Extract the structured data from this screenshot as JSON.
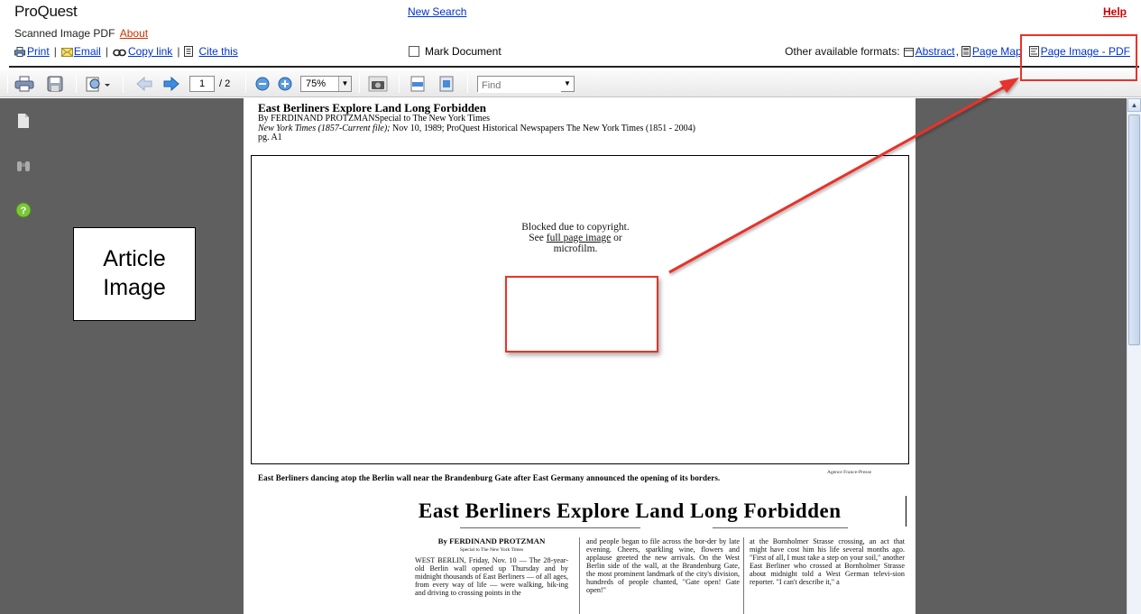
{
  "header": {
    "logo": "ProQuest",
    "new_search": "New Search",
    "help": "Help",
    "doc_type": "Scanned Image PDF",
    "about": "About",
    "actions": {
      "print": "Print",
      "email": "Email",
      "copy_link": "Copy link",
      "cite": "Cite this"
    },
    "mark_document": "Mark Document",
    "formats": {
      "label": "Other available formats:",
      "abstract": "Abstract",
      "page_map": "Page Map",
      "page_image_pdf": "Page Image - PDF"
    }
  },
  "toolbar": {
    "page_current": "1",
    "page_total": "/ 2",
    "zoom": "75%",
    "find_placeholder": "Find"
  },
  "overlay_label": "Article Image",
  "page": {
    "title": "East Berliners Explore Land Long Forbidden",
    "byline": "By FERDINAND PROTZMANSpecial to The New York Times",
    "source_italic": "New York Times  (1857-Current file);",
    "source_rest": " Nov 10, 1989; ProQuest Historical Newspapers The New York Times (1851 - 2004)",
    "page_no": "pg. A1",
    "blocked_line1": "Blocked due to copyright.",
    "blocked_see": "See ",
    "blocked_link": "full page image",
    "blocked_or": " or",
    "blocked_line3": "microfilm.",
    "photo_credit": "Agence France-Presse",
    "caption": "East Berliners dancing atop the Berlin wall near the Brandenburg Gate after East Germany announced the opening of its borders.",
    "headline": "East Berliners Explore Land Long Forbidden",
    "col1_byline": "By FERDINAND PROTZMAN",
    "col1_special": "Special to The New York Times",
    "col1_text": "WEST BERLIN, Friday, Nov. 10 — The 28-year-old Berlin wall opened up Thursday and by midnight thousands of East Berliners — of all ages, from every way of life — were walking, bik-ing and driving to crossing points in the",
    "col2_text": "and people began to file across the bor-der by late evening. Cheers, sparkling wine, flowers and applause greeted the new arrivals. On the West Berlin side of the wall, at the Brandenburg Gate, the most prominent landmark of the city's division, hundreds of people chanted, \"Gate open! Gate open!\"",
    "col3_text": "at the Bornholmer Strasse crossing, an act that might have cost him his life several months ago. \"First of all, I must take a step on your soil,\" another East Berliner who crossed at Bornholmer Strasse about midnight told a West German televi-sion reporter. \"I can't describe it,\" a"
  },
  "colors": {
    "link": "#0033cc",
    "help": "#cc0000",
    "annotation": "#e8332a",
    "viewer_bg": "#5f5f5f"
  },
  "icons": [
    "printer-icon",
    "envelope-icon",
    "link-icon",
    "cite-icon",
    "save-icon",
    "find-icon",
    "camera-icon",
    "fit-width-icon",
    "fit-page-icon",
    "zoom-out-icon",
    "zoom-in-icon",
    "prev-page-icon",
    "next-page-icon",
    "pages-icon",
    "binoculars-icon",
    "help-icon"
  ]
}
